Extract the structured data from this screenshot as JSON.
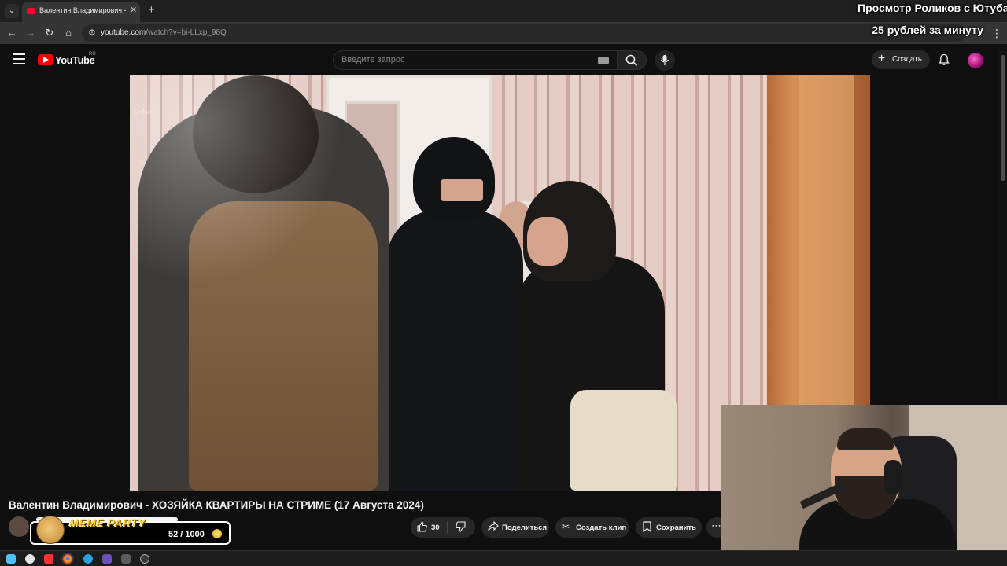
{
  "browser": {
    "tab_title": "Валентин Владимирович - ХОЗЯЙКА КВАРТИРЫ НА СТРИМЕ (17 Августа 2024)",
    "url_host": "youtube.com",
    "url_path": "/watch?v=bi-LLxp_98Q"
  },
  "overlay": {
    "line1": "Просмотр Роликов с Ютуба",
    "line2": "25 рублей за минуту"
  },
  "youtube": {
    "logo_text": "YouTube",
    "region": "RU",
    "search_placeholder": "Введите запрос",
    "create_label": "Создать"
  },
  "video": {
    "watermark": "Onlive",
    "title": "Валентин Владимирович - ХОЗЯЙКА КВАРТИРЫ НА СТРИМЕ (17 Августа 2024)"
  },
  "actions": {
    "like_count": "30",
    "share": "Поделиться",
    "clip": "Создать клип",
    "save": "Сохранить"
  },
  "meme": {
    "title": "MEME PARTY",
    "count": "52 / 1000"
  },
  "colors": {
    "youtube_red": "#ff0000",
    "meme_yellow": "#ffd54a",
    "background": "#0f0f0f"
  }
}
